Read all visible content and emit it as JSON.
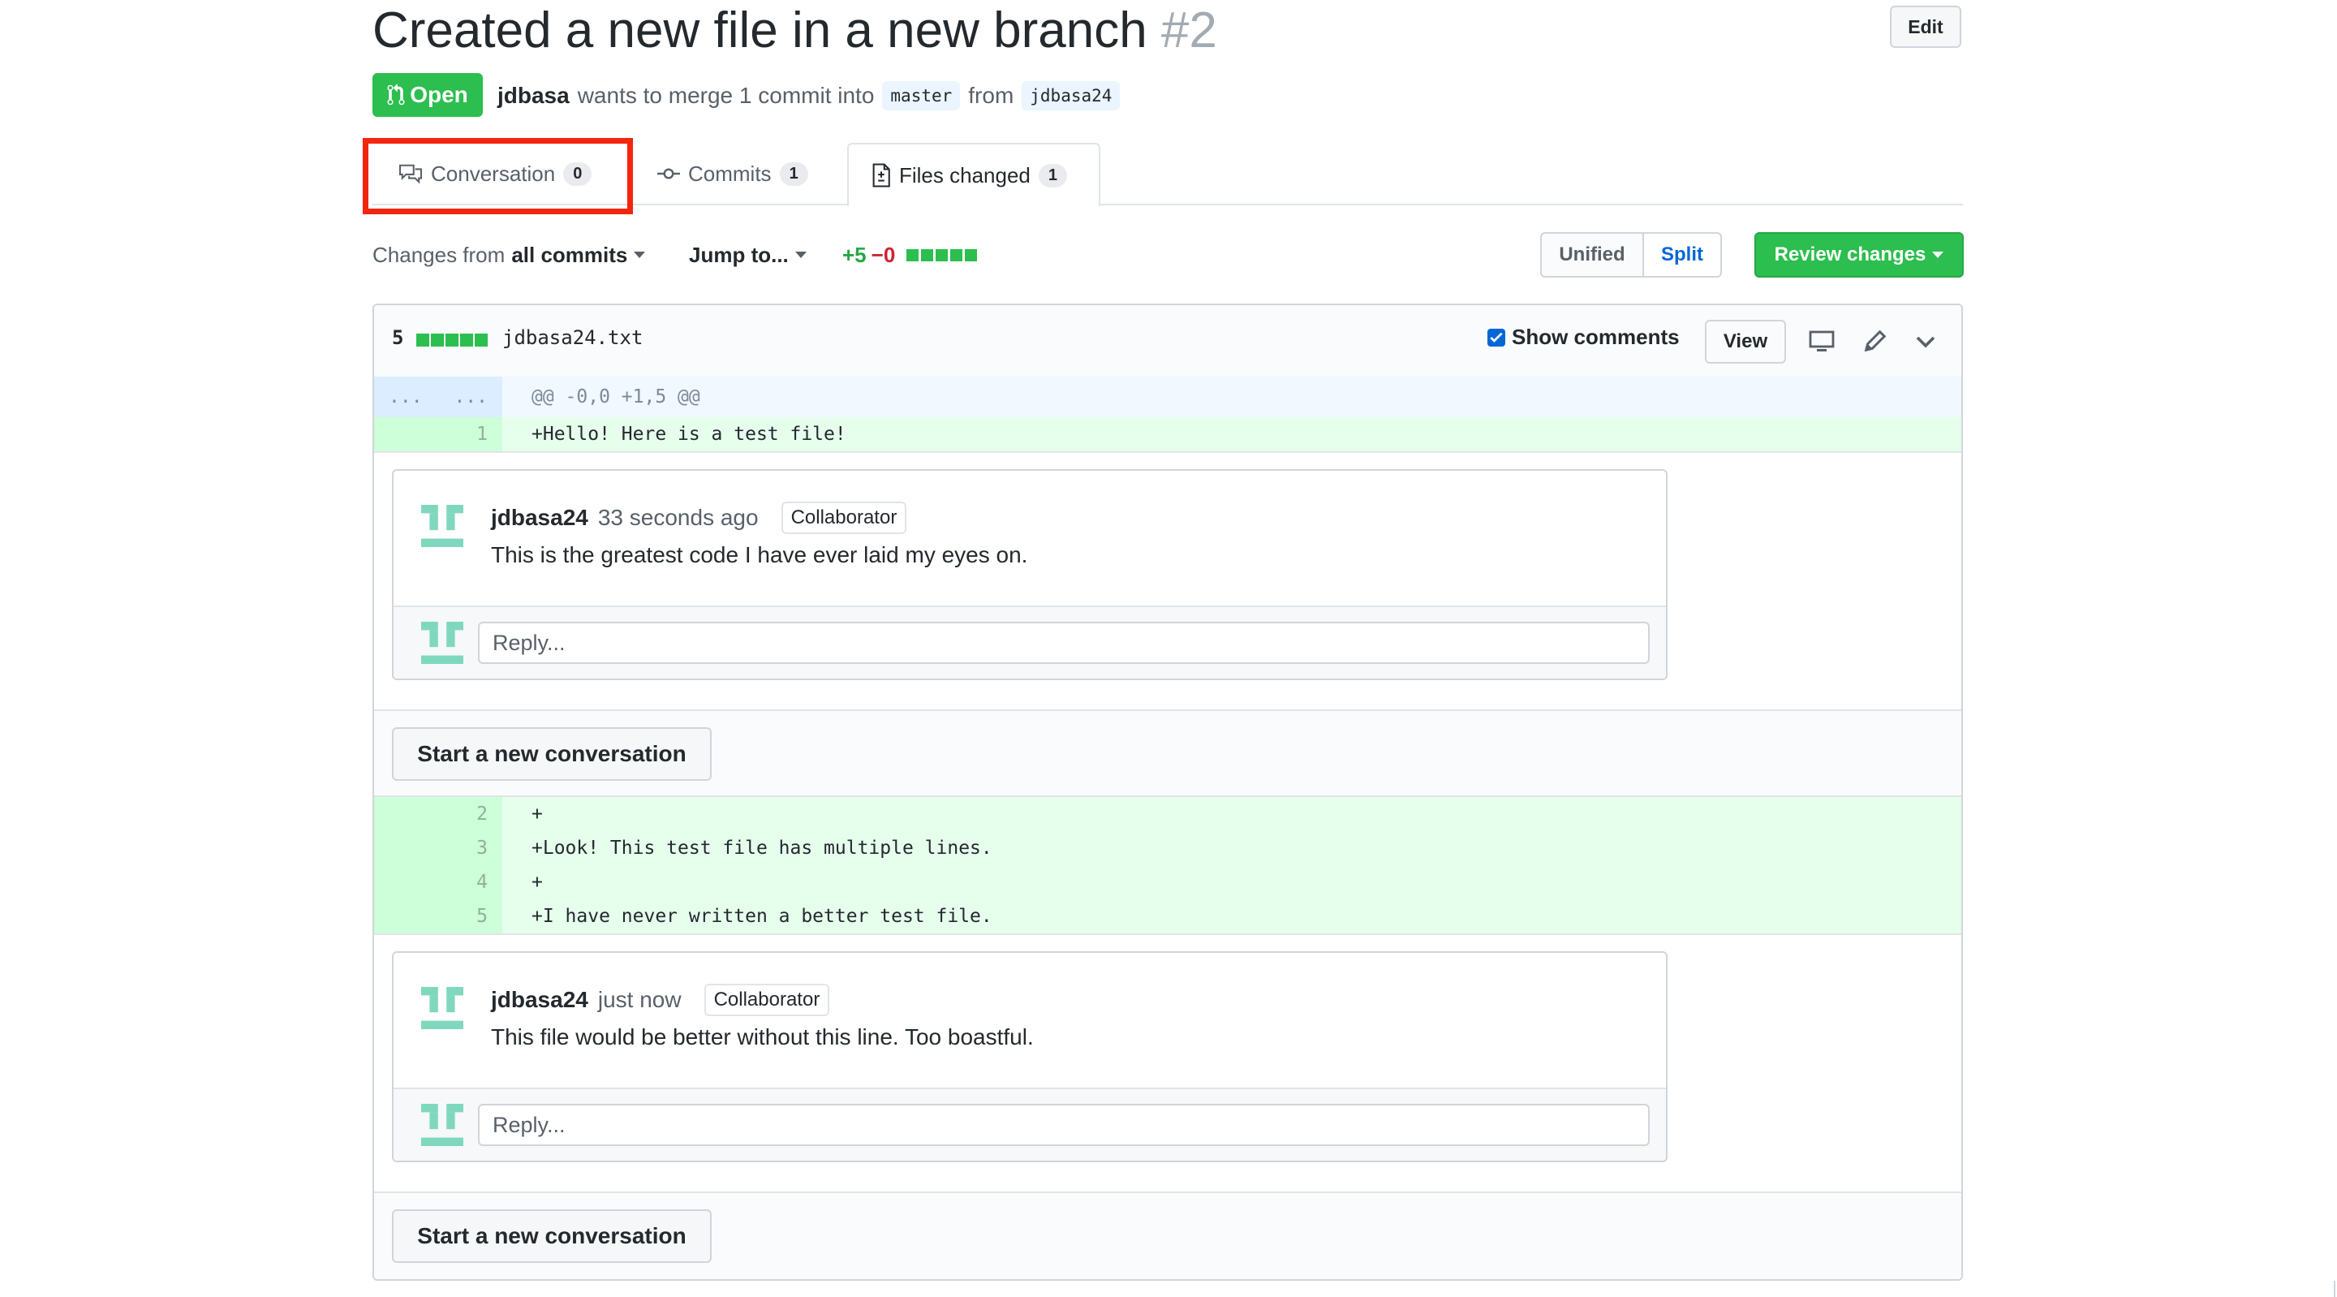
{
  "pr": {
    "title": "Created a new file in a new branch",
    "number": "#2",
    "edit_label": "Edit",
    "status": "Open",
    "author": "jdbasa",
    "merge_text": "wants to merge 1 commit into",
    "base_branch": "master",
    "from_text": "from",
    "head_branch": "jdbasa24"
  },
  "tabs": [
    {
      "label": "Conversation",
      "count": "0"
    },
    {
      "label": "Commits",
      "count": "1"
    },
    {
      "label": "Files changed",
      "count": "1"
    }
  ],
  "toolbar": {
    "changes_prefix": "Changes from",
    "changes_value": "all commits",
    "jump_label": "Jump to...",
    "additions": "+5",
    "deletions": "−0",
    "unified_label": "Unified",
    "split_label": "Split",
    "review_label": "Review changes"
  },
  "file": {
    "count": "5",
    "name": "jdbasa24.txt",
    "show_comments_label": "Show comments",
    "view_label": "View",
    "hunk_left": "...",
    "hunk_right": "...",
    "hunk_header": "@@ -0,0 +1,5 @@",
    "lines": [
      {
        "num": "1",
        "code": "+Hello! Here is a test file!"
      },
      {
        "num": "2",
        "code": "+"
      },
      {
        "num": "3",
        "code": "+Look! This test file has multiple lines."
      },
      {
        "num": "4",
        "code": "+"
      },
      {
        "num": "5",
        "code": "+I have never written a better test file."
      }
    ]
  },
  "threads": [
    {
      "author": "jdbasa24",
      "time": "33 seconds ago",
      "badge": "Collaborator",
      "text": "This is the greatest code I have ever laid my eyes on.",
      "reply_placeholder": "Reply..."
    },
    {
      "author": "jdbasa24",
      "time": "just now",
      "badge": "Collaborator",
      "text": "This file would be better without this line. Too boastful.",
      "reply_placeholder": "Reply..."
    }
  ],
  "new_conversation_label": "Start a new conversation",
  "colors": {
    "open_green": "#2cbe4e",
    "link_blue": "#0366d6",
    "highlight_red": "#f2260d",
    "addition_bg": "#e6ffed"
  },
  "icons": [
    "git-pull-request-icon",
    "comment-discussion-icon",
    "git-commit-icon",
    "file-diff-icon",
    "desktop-icon",
    "pencil-icon",
    "chevron-down-icon",
    "identicon-avatar"
  ]
}
